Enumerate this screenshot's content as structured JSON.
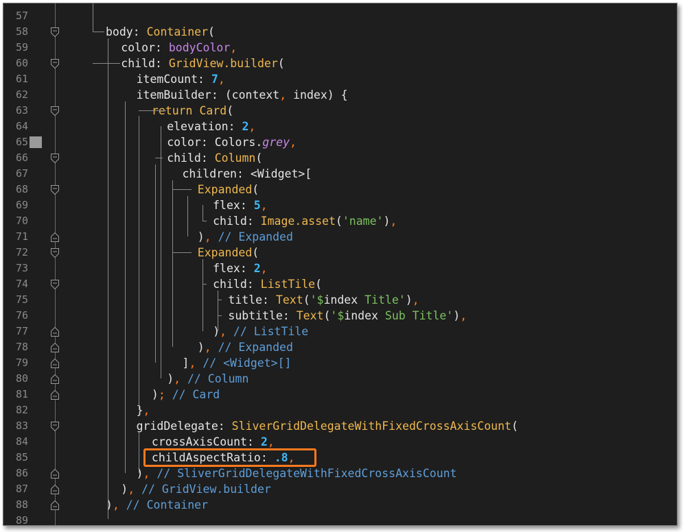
{
  "editor": {
    "lines": [
      {
        "n": "57",
        "fold": "none",
        "bp": false,
        "indent": 0,
        "tokens": []
      },
      {
        "n": "58",
        "fold": "open",
        "bp": false,
        "indent": 0,
        "tokens": [
          [
            "key",
            "body: "
          ],
          [
            "cls",
            "Container"
          ],
          [
            "key",
            "("
          ]
        ]
      },
      {
        "n": "59",
        "fold": "none",
        "bp": false,
        "indent": 1,
        "tokens": [
          [
            "key",
            "color: "
          ],
          [
            "var",
            "bodyColor"
          ],
          [
            "punct",
            ","
          ]
        ]
      },
      {
        "n": "60",
        "fold": "open",
        "bp": false,
        "indent": 1,
        "tokens": [
          [
            "key",
            "child: "
          ],
          [
            "cls",
            "GridView.builder"
          ],
          [
            "key",
            "("
          ]
        ]
      },
      {
        "n": "61",
        "fold": "none",
        "bp": false,
        "indent": 2,
        "tokens": [
          [
            "key",
            "itemCount: "
          ],
          [
            "num",
            "7"
          ],
          [
            "punct",
            ","
          ]
        ]
      },
      {
        "n": "62",
        "fold": "none",
        "bp": false,
        "indent": 2,
        "tokens": [
          [
            "key",
            "itemBuilder: (context"
          ],
          [
            "punct",
            ","
          ],
          [
            "key",
            " index) {"
          ]
        ]
      },
      {
        "n": "63",
        "fold": "open",
        "bp": false,
        "indent": 3,
        "tokens": [
          [
            "kw",
            "return "
          ],
          [
            "cls",
            "Card"
          ],
          [
            "key",
            "("
          ]
        ]
      },
      {
        "n": "64",
        "fold": "none",
        "bp": false,
        "indent": 4,
        "tokens": [
          [
            "key",
            "elevation: "
          ],
          [
            "num",
            "2"
          ],
          [
            "punct",
            ","
          ]
        ]
      },
      {
        "n": "65",
        "fold": "none",
        "bp": true,
        "indent": 4,
        "tokens": [
          [
            "key",
            "color: Colors."
          ],
          [
            "it",
            "grey"
          ],
          [
            "punct",
            ","
          ]
        ]
      },
      {
        "n": "66",
        "fold": "open",
        "bp": false,
        "indent": 4,
        "tokens": [
          [
            "key",
            "child: "
          ],
          [
            "cls",
            "Column"
          ],
          [
            "key",
            "("
          ]
        ]
      },
      {
        "n": "67",
        "fold": "none",
        "bp": false,
        "indent": 5,
        "tokens": [
          [
            "key",
            "children: <Widget>["
          ]
        ]
      },
      {
        "n": "68",
        "fold": "open",
        "bp": false,
        "indent": 6,
        "tokens": [
          [
            "cls",
            "Expanded"
          ],
          [
            "key",
            "("
          ]
        ]
      },
      {
        "n": "69",
        "fold": "none",
        "bp": false,
        "indent": 7,
        "tokens": [
          [
            "key",
            "flex: "
          ],
          [
            "num",
            "5"
          ],
          [
            "punct",
            ","
          ]
        ]
      },
      {
        "n": "70",
        "fold": "none",
        "bp": false,
        "indent": 7,
        "tokens": [
          [
            "key",
            "child: "
          ],
          [
            "cls",
            "Image.asset"
          ],
          [
            "key",
            "("
          ],
          [
            "str",
            "'name'"
          ],
          [
            "key",
            ")"
          ],
          [
            "punct",
            ","
          ]
        ]
      },
      {
        "n": "71",
        "fold": "close",
        "bp": false,
        "indent": 6,
        "tokens": [
          [
            "key",
            ")"
          ],
          [
            "punct",
            ","
          ],
          [
            "cm",
            " // Expanded"
          ]
        ]
      },
      {
        "n": "72",
        "fold": "open",
        "bp": false,
        "indent": 6,
        "tokens": [
          [
            "cls",
            "Expanded"
          ],
          [
            "key",
            "("
          ]
        ]
      },
      {
        "n": "73",
        "fold": "none",
        "bp": false,
        "indent": 7,
        "tokens": [
          [
            "key",
            "flex: "
          ],
          [
            "num",
            "2"
          ],
          [
            "punct",
            ","
          ]
        ]
      },
      {
        "n": "74",
        "fold": "open",
        "bp": false,
        "indent": 7,
        "tokens": [
          [
            "key",
            "child: "
          ],
          [
            "cls",
            "ListTile"
          ],
          [
            "key",
            "("
          ]
        ]
      },
      {
        "n": "75",
        "fold": "none",
        "bp": false,
        "indent": 8,
        "tokens": [
          [
            "key",
            "title: "
          ],
          [
            "cls",
            "Text"
          ],
          [
            "key",
            "("
          ],
          [
            "str",
            "'$"
          ],
          [
            "key",
            "index"
          ],
          [
            "str",
            " Title'"
          ],
          [
            "key",
            ")"
          ],
          [
            "punct",
            ","
          ]
        ]
      },
      {
        "n": "76",
        "fold": "none",
        "bp": false,
        "indent": 8,
        "tokens": [
          [
            "key",
            "subtitle: "
          ],
          [
            "cls",
            "Text"
          ],
          [
            "key",
            "("
          ],
          [
            "str",
            "'$"
          ],
          [
            "key",
            "index"
          ],
          [
            "str",
            " Sub Title'"
          ],
          [
            "key",
            ")"
          ],
          [
            "punct",
            ","
          ]
        ]
      },
      {
        "n": "77",
        "fold": "close",
        "bp": false,
        "indent": 7,
        "tokens": [
          [
            "key",
            ")"
          ],
          [
            "punct",
            ","
          ],
          [
            "cm",
            " // ListTile"
          ]
        ]
      },
      {
        "n": "78",
        "fold": "close",
        "bp": false,
        "indent": 6,
        "tokens": [
          [
            "key",
            ")"
          ],
          [
            "punct",
            ","
          ],
          [
            "cm",
            " // Expanded"
          ]
        ]
      },
      {
        "n": "79",
        "fold": "close",
        "bp": false,
        "indent": 5,
        "tokens": [
          [
            "key",
            "]"
          ],
          [
            "punct",
            ","
          ],
          [
            "cm",
            " // <Widget>[]"
          ]
        ]
      },
      {
        "n": "80",
        "fold": "close",
        "bp": false,
        "indent": 4,
        "tokens": [
          [
            "key",
            ")"
          ],
          [
            "punct",
            ","
          ],
          [
            "cm",
            " // Column"
          ]
        ]
      },
      {
        "n": "81",
        "fold": "close",
        "bp": false,
        "indent": 3,
        "tokens": [
          [
            "key",
            ")"
          ],
          [
            "punct",
            ";"
          ],
          [
            "cm",
            " // Card"
          ]
        ]
      },
      {
        "n": "82",
        "fold": "none",
        "bp": false,
        "indent": 2,
        "tokens": [
          [
            "key",
            "}"
          ],
          [
            "punct",
            ","
          ]
        ]
      },
      {
        "n": "83",
        "fold": "open",
        "bp": false,
        "indent": 2,
        "tokens": [
          [
            "key",
            "gridDelegate: "
          ],
          [
            "cls",
            "SliverGridDelegateWithFixedCrossAxisCount"
          ],
          [
            "key",
            "("
          ]
        ]
      },
      {
        "n": "84",
        "fold": "none",
        "bp": false,
        "indent": 3,
        "tokens": [
          [
            "key",
            "crossAxisCount: "
          ],
          [
            "num",
            "2"
          ],
          [
            "punct",
            ","
          ]
        ]
      },
      {
        "n": "85",
        "fold": "none",
        "bp": false,
        "indent": 3,
        "tokens": [
          [
            "key",
            "childAspectRatio: "
          ],
          [
            "num",
            ".8"
          ],
          [
            "punct",
            ","
          ]
        ]
      },
      {
        "n": "86",
        "fold": "close",
        "bp": false,
        "indent": 2,
        "tokens": [
          [
            "key",
            ")"
          ],
          [
            "punct",
            ","
          ],
          [
            "cm",
            " // SliverGridDelegateWithFixedCrossAxisCount"
          ]
        ]
      },
      {
        "n": "87",
        "fold": "close",
        "bp": false,
        "indent": 1,
        "tokens": [
          [
            "key",
            ")"
          ],
          [
            "punct",
            ","
          ],
          [
            "cm",
            " // GridView.builder"
          ]
        ]
      },
      {
        "n": "88",
        "fold": "close",
        "bp": false,
        "indent": 0,
        "tokens": [
          [
            "key",
            ")"
          ],
          [
            "punct",
            ","
          ],
          [
            "cm",
            " // Container"
          ]
        ]
      },
      {
        "n": "89",
        "fold": "none",
        "bp": false,
        "indent": 0,
        "tokens": []
      }
    ]
  },
  "colors": {
    "background": "#1e1e1e",
    "class": "#f0b84e",
    "number": "#42b8f5",
    "string": "#7cc160",
    "comment": "#5f9ed8",
    "punctuation": "#ff7a1f",
    "variable": "#c586e6",
    "highlight_border": "#ff7a1f"
  }
}
